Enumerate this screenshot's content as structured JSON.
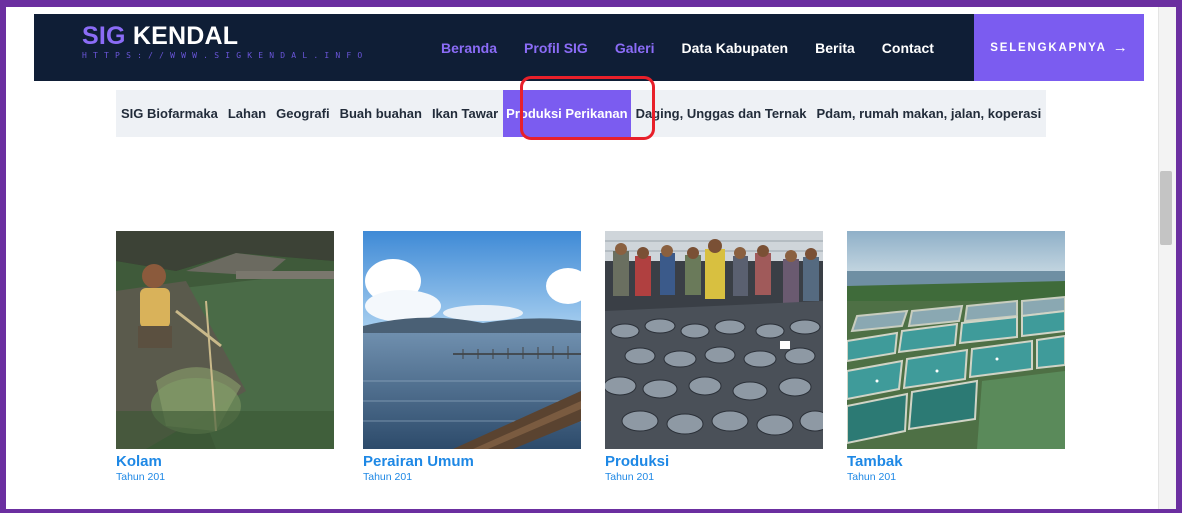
{
  "header": {
    "logo_accent": "SIG",
    "logo_rest": " KENDAL",
    "logo_url": "HTTPS://WWW.SIGKENDAL.INFO",
    "nav": [
      {
        "label": "Beranda"
      },
      {
        "label": "Profil SIG"
      },
      {
        "label": "Galeri"
      },
      {
        "label": "Data Kabupaten"
      },
      {
        "label": "Berita"
      },
      {
        "label": "Contact"
      }
    ],
    "cta_label": "SELENGKAPNYA",
    "cta_arrow": "→"
  },
  "tabs": [
    {
      "label": "SIG Biofarmaka"
    },
    {
      "label": "Lahan"
    },
    {
      "label": "Geografi"
    },
    {
      "label": "Buah buahan"
    },
    {
      "label": "Ikan Tawar"
    },
    {
      "label": "Produksi Perikanan"
    },
    {
      "label": "Daging, Unggas dan Ternak"
    },
    {
      "label": "Pdam, rumah makan, jalan, koperasi"
    }
  ],
  "gallery": [
    {
      "title": "Kolam",
      "subtitle": "Tahun 201"
    },
    {
      "title": "Perairan Umum",
      "subtitle": "Tahun 201"
    },
    {
      "title": "Produksi",
      "subtitle": "Tahun 201"
    },
    {
      "title": "Tambak",
      "subtitle": "Tahun 201"
    }
  ],
  "colors": {
    "header_bg": "#0f1e36",
    "accent": "#7b5cf0",
    "link": "#1e88e5",
    "highlight": "#e8202a",
    "frame": "#6b2fa0"
  }
}
